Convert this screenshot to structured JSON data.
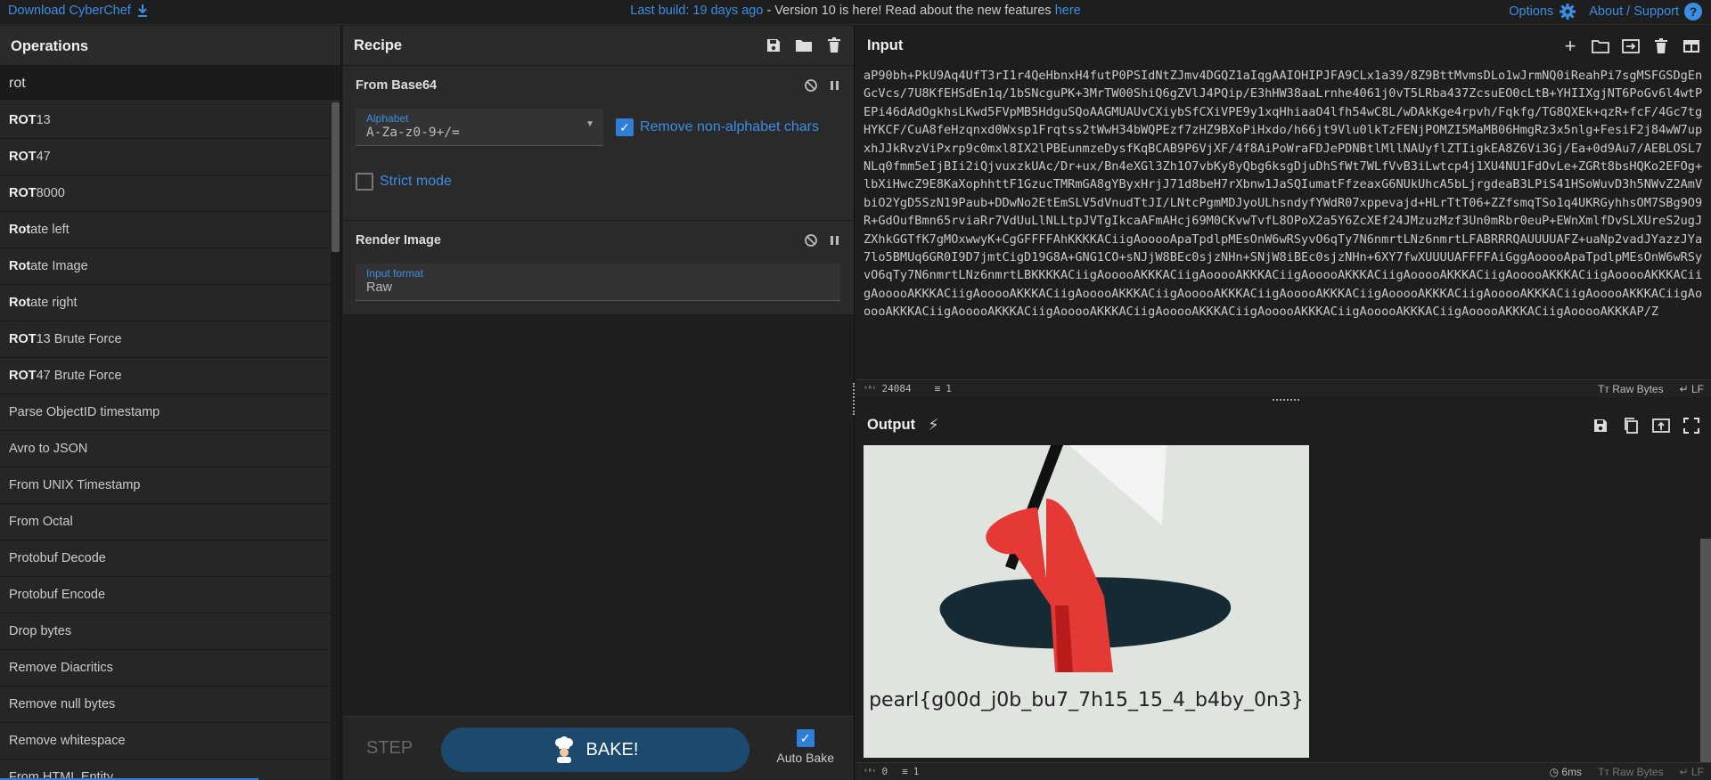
{
  "banner": {
    "download_label": "Download CyberChef",
    "last_build": "Last build: 19 days ago",
    "message": " - Version 10 is here! Read about the new features ",
    "here_link": "here",
    "options_label": "Options",
    "about_label": "About / Support"
  },
  "operations": {
    "title": "Operations",
    "search_value": "rot",
    "items": [
      {
        "bold": "ROT",
        "rest": "13"
      },
      {
        "bold": "ROT",
        "rest": "47"
      },
      {
        "bold": "ROT",
        "rest": "8000"
      },
      {
        "bold": "Rot",
        "rest": "ate left"
      },
      {
        "bold": "Rot",
        "rest": "ate Image"
      },
      {
        "bold": "Rot",
        "rest": "ate right"
      },
      {
        "bold": "ROT",
        "rest": "13 Brute Force"
      },
      {
        "bold": "ROT",
        "rest": "47 Brute Force"
      },
      {
        "bold": "",
        "rest": "Parse ObjectID timestamp"
      },
      {
        "bold": "",
        "rest": "Avro to JSON"
      },
      {
        "bold": "",
        "rest": "From UNIX Timestamp"
      },
      {
        "bold": "",
        "rest": "From Octal"
      },
      {
        "bold": "",
        "rest": "Protobuf Decode"
      },
      {
        "bold": "",
        "rest": "Protobuf Encode"
      },
      {
        "bold": "",
        "rest": "Drop bytes"
      },
      {
        "bold": "",
        "rest": "Remove Diacritics"
      },
      {
        "bold": "",
        "rest": "Remove null bytes"
      },
      {
        "bold": "",
        "rest": "Remove whitespace"
      },
      {
        "bold": "",
        "rest": "From HTML Entity"
      }
    ]
  },
  "recipe": {
    "title": "Recipe",
    "op1": {
      "name": "From Base64",
      "alphabet_label": "Alphabet",
      "alphabet_value": "A-Za-z0-9+/=",
      "remove_label": "Remove non-alphabet chars",
      "strict_label": "Strict mode"
    },
    "op2": {
      "name": "Render Image",
      "format_label": "Input format",
      "format_value": "Raw"
    },
    "step_label": "STEP",
    "bake_label": "BAKE!",
    "autobake_label": "Auto Bake"
  },
  "input": {
    "title": "Input",
    "text": "aP90bh+PkU9Aq4UfT3rI1r4QeHbnxH4futP0PSIdNtZJmv4DGQZ1aIqgAAIOHIPJFA9CLx1a39/8Z9BttMvmsDLo1wJrmNQ0iReahPi7sgMSFGSDgEnGcVcs/7U8KfEHSdEn1q/1bSNcguPK+3MrTW00ShiQ6gZVlJ4PQip/E3hHW38aaLrnhe4061j0vT5LRba437ZcsuEO0cLtB+YHIIXgjNT6PoGv6l4wtPEPi46dAdOgkhsLKwd5FVpMB5HdguSQoAAGMUAUvCXiybSfCXiVPE9y1xqHhiaaO4lfh54wC8L/wDAkKge4rpvh/Fqkfg/TG8QXEk+qzR+fcF/4Gc7tgHYKCF/CuA8feHzqnxd0Wxsp1Frqtss2tWwH34bWQPEzf7zHZ9BXoPiHxdo/h66jt9Vlu0lkTzFENjPOMZI5MaMB06HmgRz3x5nlg+FesiF2j84wW7upxhJJkRvzViPxrp9c0mxl8IX2lPBEunmzeDysfKqBCAB9P6VjXF/4f8AiPoWraFDJePDNBtlMllNAUyflZTIigkEA8Z6Vi3Gj/Ea+0d9Au7/AEBLOSL7NLq0fmm5eIjBIi2iQjvuxzkUAc/Dr+ux/Bn4eXGl3Zh1O7vbKy8yQbg6ksgDjuDhSfWt7WLfVvB3iLwtcp4j1XU4NU1FdOvLe+ZGRt8bsHQKo2EFOg+lbXiHwcZ9E8KaXophhttF1GzucTMRmGA8gYByxHrjJ71d8beH7rXbnw1JaSQIumatFfzeaxG6NUkUhcA5bLjrgdeaB3LPiS41HSoWuvD3h5NWvZ2AmVbiO2YgD5SzN19Paub+DDwNo2EtEmSLV5dVnudTtJI/LNtcPgmMDJyoULhsndyfYWdR07xppevajd+HLrTtT06+ZZfsmqTSo1q4UKRGyhhsOM7SBg9O9R+GdOufBmn65rviaRr7VdUuLlNLLtpJVTgIkcaAFmAHcj69M0CKvwTvfL8OPoX2a5Y6ZcXEf24JMzuzMzf3Un0mRbr0euP+EWnXmlfDvSLXUreS2ugJZXhkGGTfK7gMOxwwyK+CgGFFFFAhKKKKACiigAooooApaTpdlpMEsOnW6wRSyvO6qTy7N6nmrtLNz6nmrtLFABRRRQAUUUUAFZ+uaNp2vadJYazzJYa7lo5BMUq6GR0I9D7jmtCigD19G8A+GNG1CO+sNJjW8BEc0sjzNHn+SNjW8iBEc0sjzNHn+6XY7fwXUUUUAFFFFAiGggAooooApaTpdlpMEsOnW6wRSyvO6qTy7N6nmrtLNz6nmrtLBKKKKACiigAooooAKKKACiigAooooAKKKACiigAooooAKKKACiigAooooAKKKACiigAooooAKKKACiigAooooAKKKACiigAooooAKKKACiigAooooAKKKACiigAooooAKKKACiigAooooAKKKACiigAooooAKKKACiigAooooAKKKACiigAooooAKKKACiigAooooAKKKACiigAooooAKKKACiigAooooAKKKACiigAooooAKKKACiigAooooAKKKACiigAooooAKKKACiigAooooAKKKACiigAooooAKKKACiigAooooAKKKAP/Z",
    "status_chars": "24084",
    "status_lines": "1",
    "raw_bytes": "Raw Bytes",
    "eol": "LF"
  },
  "output": {
    "title": "Output",
    "image_text": "pearl{g00d_j0b_bu7_7h15_15_4_b4by_0n3}",
    "status_chars": "0",
    "status_lines": "1",
    "time": "6ms",
    "raw_bytes": "Raw Bytes",
    "eol": "LF"
  }
}
